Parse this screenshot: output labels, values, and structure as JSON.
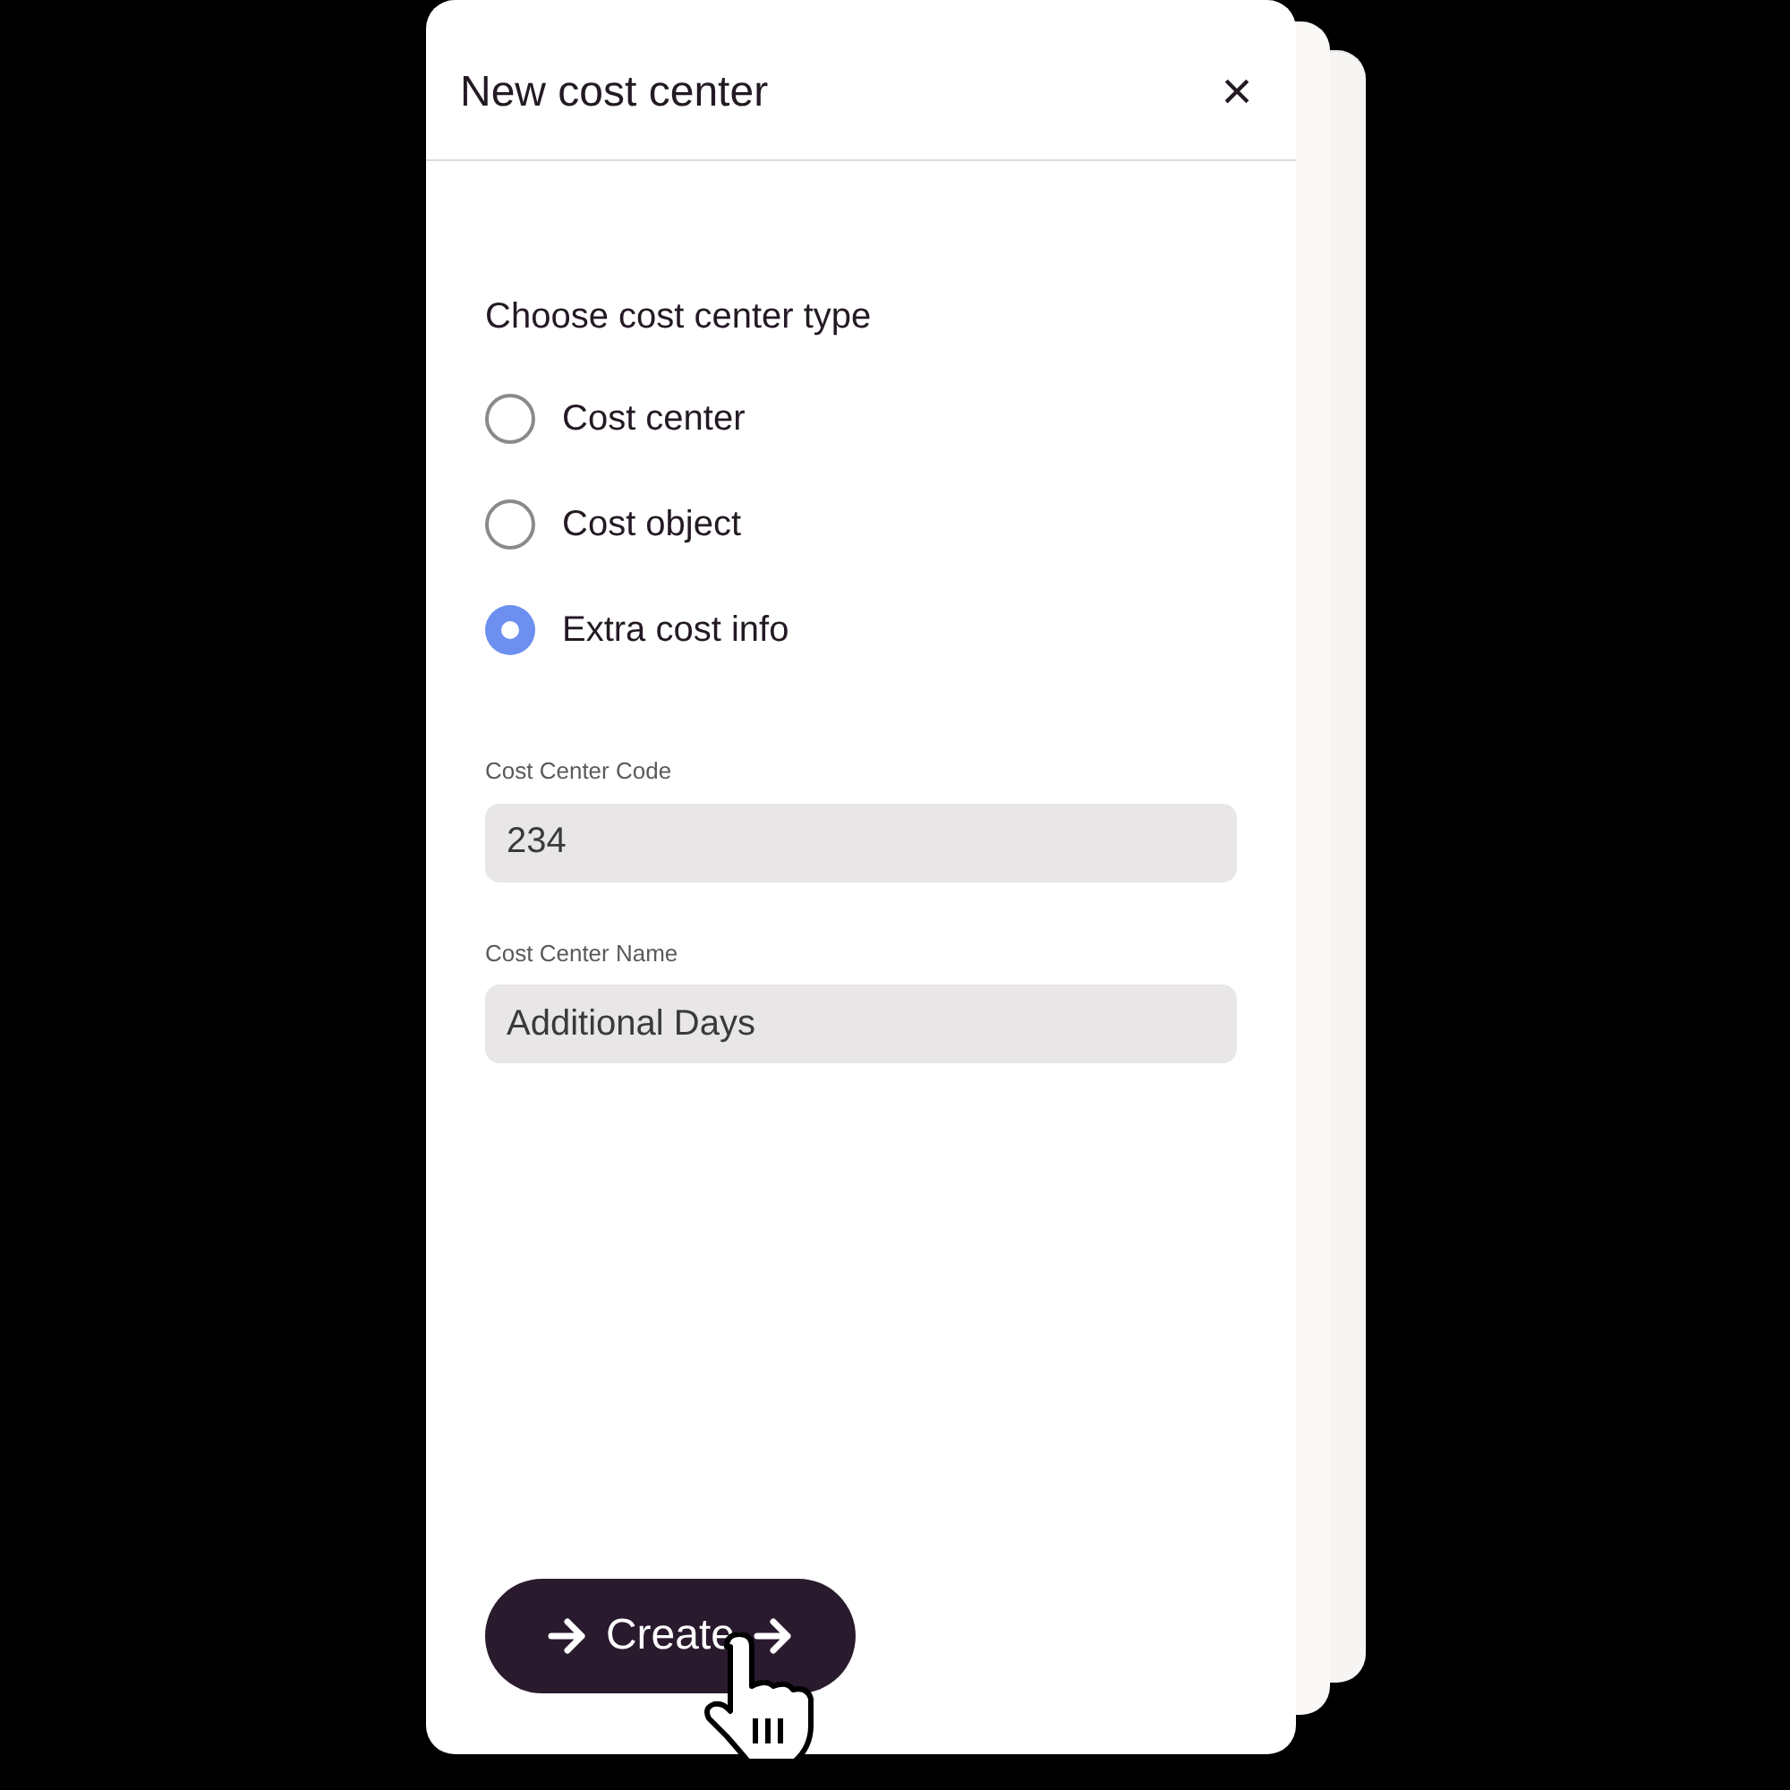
{
  "dialog": {
    "title": "New cost center",
    "close": "×"
  },
  "type_choice": {
    "heading": "Choose cost center type",
    "options": [
      {
        "label": "Cost center",
        "selected": false
      },
      {
        "label": "Cost object",
        "selected": false
      },
      {
        "label": "Extra cost info",
        "selected": true
      }
    ]
  },
  "fields": [
    {
      "label": "Cost Center Code",
      "value": "234"
    },
    {
      "label": "Cost Center Name",
      "value": "Additional Days"
    }
  ],
  "create_button": {
    "label": "Create"
  }
}
